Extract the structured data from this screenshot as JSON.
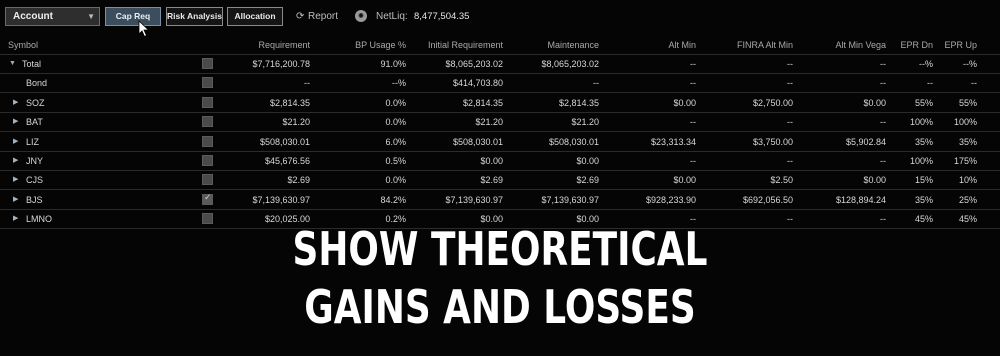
{
  "toolbar": {
    "account_label": "Account",
    "tabs": [
      {
        "label": "Cap Req",
        "active": true
      },
      {
        "label": "Risk Analysis",
        "active": false
      },
      {
        "label": "Allocation",
        "active": false
      }
    ],
    "report_label": "Report",
    "netliq_label": "NetLiq:",
    "netliq_value": "8,477,504.35"
  },
  "table": {
    "headers": [
      "Symbol",
      "Requirement",
      "BP Usage %",
      "Initial Requirement",
      "Maintenance",
      "Alt Min",
      "FINRA Alt Min",
      "Alt Min Vega",
      "EPR Dn",
      "EPR Up"
    ],
    "rows": [
      {
        "symbol": "Total",
        "caret": "open",
        "checked": false,
        "values": [
          "$7,716,200.78",
          "91.0%",
          "$8,065,203.02",
          "$8,065,203.02",
          "--",
          "--",
          "--",
          "--%",
          "--%"
        ]
      },
      {
        "symbol": "Bond",
        "caret": "none",
        "checked": false,
        "values": [
          "--",
          "--%",
          "$414,703.80",
          "--",
          "--",
          "--",
          "--",
          "--",
          "--"
        ]
      },
      {
        "symbol": "SOZ",
        "caret": "closed",
        "checked": false,
        "values": [
          "$2,814.35",
          "0.0%",
          "$2,814.35",
          "$2,814.35",
          "$0.00",
          "$2,750.00",
          "$0.00",
          "55%",
          "55%"
        ]
      },
      {
        "symbol": "BAT",
        "caret": "closed",
        "checked": false,
        "values": [
          "$21.20",
          "0.0%",
          "$21.20",
          "$21.20",
          "--",
          "--",
          "--",
          "100%",
          "100%"
        ]
      },
      {
        "symbol": "LIZ",
        "caret": "closed",
        "checked": false,
        "values": [
          "$508,030.01",
          "6.0%",
          "$508,030.01",
          "$508,030.01",
          "$23,313.34",
          "$3,750.00",
          "$5,902.84",
          "35%",
          "35%"
        ]
      },
      {
        "symbol": "JNY",
        "caret": "closed",
        "checked": false,
        "values": [
          "$45,676.56",
          "0.5%",
          "$0.00",
          "$0.00",
          "--",
          "--",
          "--",
          "100%",
          "175%"
        ]
      },
      {
        "symbol": "CJS",
        "caret": "closed",
        "checked": false,
        "values": [
          "$2.69",
          "0.0%",
          "$2.69",
          "$2.69",
          "$0.00",
          "$2.50",
          "$0.00",
          "15%",
          "10%"
        ]
      },
      {
        "symbol": "BJS",
        "caret": "closed",
        "checked": true,
        "values": [
          "$7,139,630.97",
          "84.2%",
          "$7,139,630.97",
          "$7,139,630.97",
          "$928,233.90",
          "$692,056.50",
          "$128,894.24",
          "35%",
          "25%"
        ]
      },
      {
        "symbol": "LMNO",
        "caret": "closed",
        "checked": false,
        "values": [
          "$20,025.00",
          "0.2%",
          "$0.00",
          "$0.00",
          "--",
          "--",
          "--",
          "45%",
          "45%"
        ]
      }
    ]
  },
  "overlay": {
    "line1": "SHOW THEORETICAL",
    "line2": "GAINS AND LOSSES"
  }
}
